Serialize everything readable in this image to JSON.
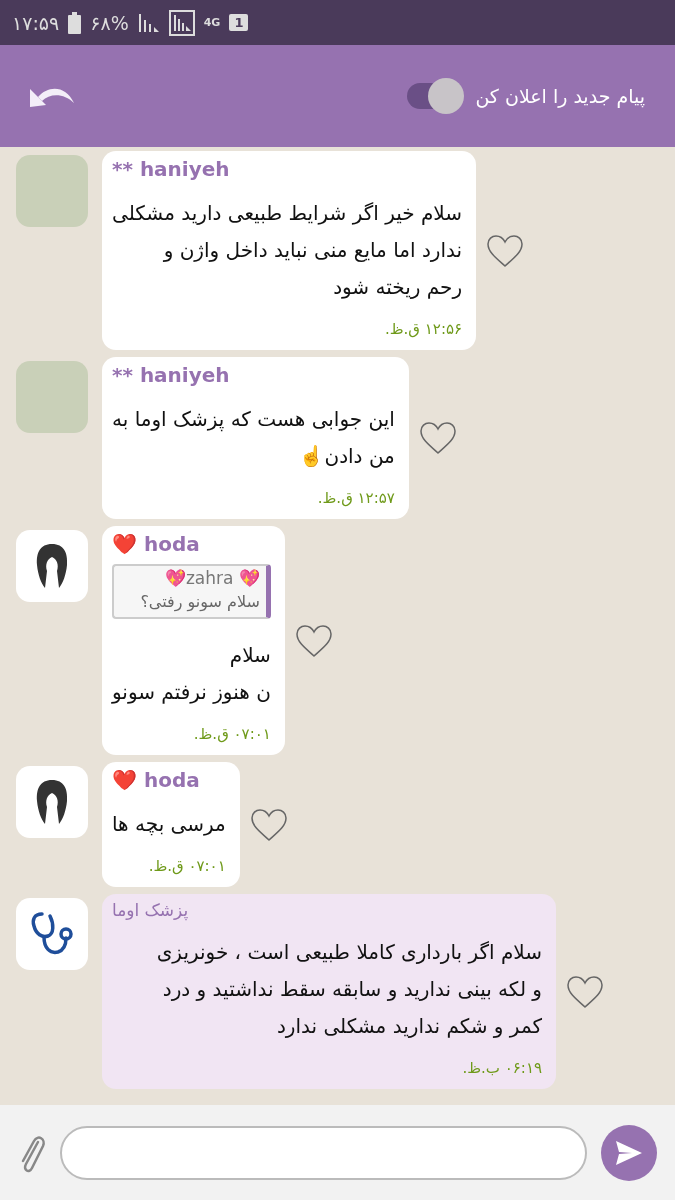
{
  "status_bar": {
    "time": "۱۷:۵۹",
    "battery": "۶۸%",
    "network": "4G",
    "sim": "1"
  },
  "header": {
    "notify_label": "پیام جدید را اعلان کن",
    "notify_on": true
  },
  "messages": [
    {
      "avatar": {
        "kind": "photo"
      },
      "kind": "member",
      "sender": "** haniyeh",
      "lines": [
        "سلام خیر اگر شرایط طبیعی دارید مشکلی",
        "ندارد اما مایع منی نباید داخل واژن و",
        "رحم ریخته شود"
      ],
      "time": "۱۲:۵۶ ق.ظ.",
      "liked": false
    },
    {
      "avatar": {
        "kind": "photo"
      },
      "kind": "member",
      "sender": "** haniyeh",
      "lines": [
        "این جوابی هست که پزشک اوما به",
        "من دادن☝️"
      ],
      "time": "۱۲:۵۷ ق.ظ.",
      "liked": false
    },
    {
      "avatar": {
        "kind": "silhouette"
      },
      "kind": "member",
      "sender": "❤️ hoda",
      "reply": {
        "sender": "💖zahra 💖",
        "text": "سلام سونو رفتی؟"
      },
      "lines": [
        "سلام",
        "ن هنوز نرفتم سونو"
      ],
      "time": "۰۷:۰۱ ق.ظ.",
      "liked": false
    },
    {
      "avatar": {
        "kind": "silhouette"
      },
      "kind": "member",
      "sender": "❤️ hoda",
      "lines": [
        "مرسی بچه ها"
      ],
      "time": "۰۷:۰۱ ق.ظ.",
      "liked": false
    },
    {
      "avatar": {
        "kind": "stethoscope"
      },
      "kind": "official",
      "sender": "پزشک اوما",
      "lines": [
        "سلام اگر بارداری کاملا طبیعی است ، خونریزی",
        "و لکه بینی ندارید و سابقه سقط نداشتید و درد",
        "کمر و شکم ندارید مشکلی ندارد"
      ],
      "time": "۰۶:۱۹ ب.ظ.",
      "liked": false
    }
  ]
}
